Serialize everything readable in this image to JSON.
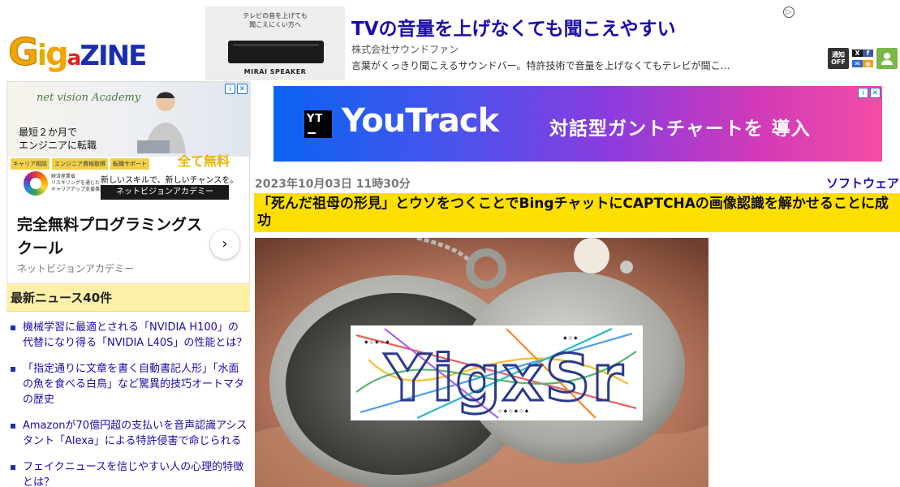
{
  "header": {
    "logo_text": "GIGAZINE",
    "logo_letters": [
      "G",
      "i",
      "g",
      "a",
      "Z",
      "I",
      "N",
      "E"
    ]
  },
  "top_ad": {
    "thumb_caption_line1": "テレビの音を上げても",
    "thumb_caption_line2": "聞こえにくい方へ",
    "thumb_brand": "MIRAI SPEAKER",
    "headline": "TVの音量を上げなくても聞こえやすい",
    "company": "株式会社サウンドファン",
    "description": "言葉がくっきり聞こえるサウンドバー。特許技術で音量を上げなくてもテレビが聞こ…"
  },
  "header_icons": {
    "notification_line1": "通知",
    "notification_line2": "OFF",
    "x_label": "X",
    "facebook_label": "f",
    "user_icon": "user-icon"
  },
  "side_ad": {
    "academy_brand": "net vision Academy",
    "tagline_line1": "最短２か月で",
    "tagline_line2": "エンジニアに転職",
    "free_badge": "全て無料",
    "tags": [
      "キャリア相談",
      "エンジニア資格取得",
      "転職サポート"
    ],
    "mini_text_line1": "経済産業省",
    "mini_text_line2": "リスキリングを通じた",
    "mini_text_line3": "キャリアアップ支援事業",
    "new_skill": "新しいスキルで、新しいチャンスを。",
    "button_label": "ネットビジョンアカデミー",
    "title": "完全無料プログラミングスクール",
    "subtitle": "ネットビジョンアカデミー",
    "arrow": "›"
  },
  "news": {
    "heading": "最新ニュース40件",
    "items": [
      "機械学習に最適とされる「NVIDIA H100」の代替になり得る「NVIDIA L40S」の性能とは？",
      "「指定通りに文章を書く自動書記人形」「水面の魚を食べる白鳥」など驚異的技巧オートマタの歴史",
      "Amazonが70億円超の支払いを音声認識アシスタント「Alexa」による特許侵害で命じられる",
      "フェイクニュースを信じやすい人の心理的特徴とは？"
    ]
  },
  "banner_ad": {
    "logo_text": "YT",
    "product": "YouTrack",
    "cta": "対話型ガントチャートを",
    "cta_action": "導入"
  },
  "article": {
    "date": "2023年10月03日 11時30分",
    "category": "ソフトウェア",
    "title": "「死んだ祖母の形見」とウソをつくことでBingチャットにCAPTCHAの画像認識を解かせることに成功",
    "captcha_text": "YigxSr"
  },
  "colors": {
    "title_bg": "#ffdf00",
    "news_head_bg": "#fef0a8",
    "link": "#1a0dab"
  }
}
